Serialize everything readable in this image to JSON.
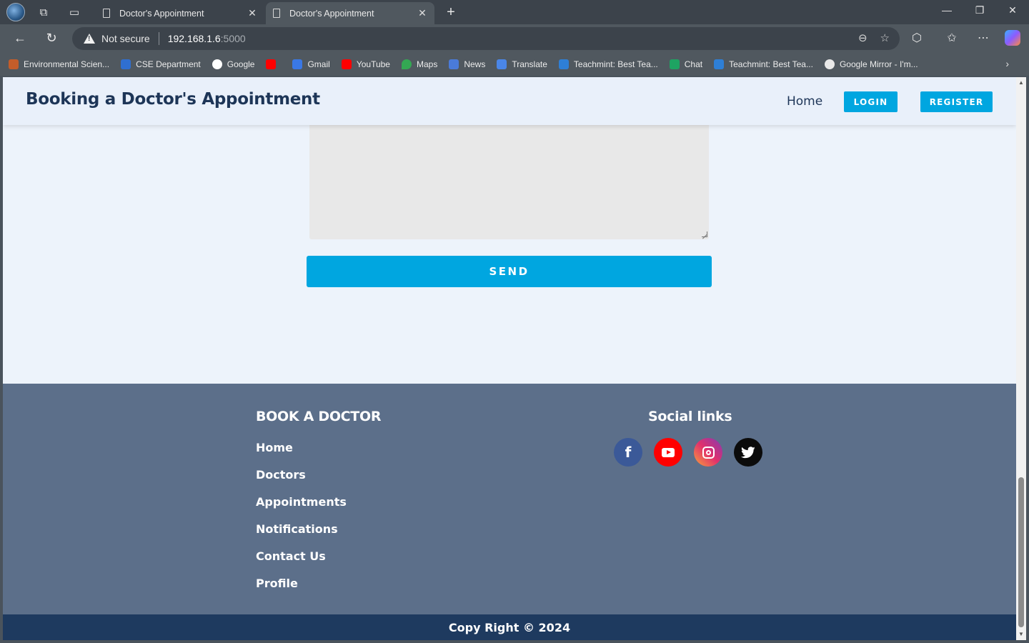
{
  "browser": {
    "tabs": [
      {
        "title": "Doctor's Appointment"
      },
      {
        "title": "Doctor's Appointment"
      }
    ],
    "security_label": "Not secure",
    "url_host": "192.168.1.6",
    "url_port": ":5000",
    "bookmarks": [
      {
        "label": "Environmental Scien...",
        "color": "#c45d2a"
      },
      {
        "label": "CSE Department",
        "color": "#2f6fd1"
      },
      {
        "label": "Google",
        "color": "#ffffff"
      },
      {
        "label": "",
        "color": "#ff0000"
      },
      {
        "label": "Gmail",
        "color": "#3a78e6"
      },
      {
        "label": "YouTube",
        "color": "#ff0000"
      },
      {
        "label": "Maps",
        "color": "#34a853"
      },
      {
        "label": "News",
        "color": "#4a7bd9"
      },
      {
        "label": "Translate",
        "color": "#4a86e8"
      },
      {
        "label": "Teachmint: Best Tea...",
        "color": "#2e7fd6"
      },
      {
        "label": "Chat",
        "color": "#1ea362"
      },
      {
        "label": "Teachmint: Best Tea...",
        "color": "#2e7fd6"
      },
      {
        "label": "Google Mirror - I'm...",
        "color": "#e8e8e8"
      }
    ]
  },
  "header": {
    "brand": "Booking a Doctor's Appointment",
    "nav_home": "Home",
    "login": "LOGIN",
    "register": "REGISTER"
  },
  "form": {
    "send_label": "SEND"
  },
  "footer": {
    "title": "BOOK A DOCTOR",
    "links": [
      "Home",
      "Doctors",
      "Appointments",
      "Notifications",
      "Contact Us",
      "Profile"
    ],
    "social_title": "Social links",
    "social": [
      {
        "name": "facebook",
        "glyph": "f"
      },
      {
        "name": "youtube",
        "glyph": ""
      },
      {
        "name": "instagram",
        "glyph": ""
      },
      {
        "name": "twitter",
        "glyph": "🐦"
      }
    ],
    "copyright": "Copy Right © 2024"
  }
}
